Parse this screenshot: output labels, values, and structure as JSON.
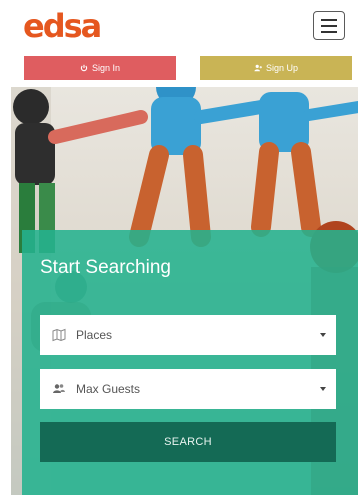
{
  "header": {
    "logo_text": "edsa",
    "menu_icon": "hamburger-icon"
  },
  "auth": {
    "signin_label": "Sign In",
    "signin_icon": "power-icon",
    "signup_label": "Sign Up",
    "signup_icon": "user-plus-icon",
    "signin_color": "#df5d60",
    "signup_color": "#c9b455"
  },
  "search": {
    "title": "Start Searching",
    "places_value": "Places",
    "places_icon": "map-icon",
    "guests_value": "Max Guests",
    "guests_icon": "users-icon",
    "button_label": "SEARCH",
    "accent_color": "#24b28e",
    "button_color": "#146a55"
  }
}
